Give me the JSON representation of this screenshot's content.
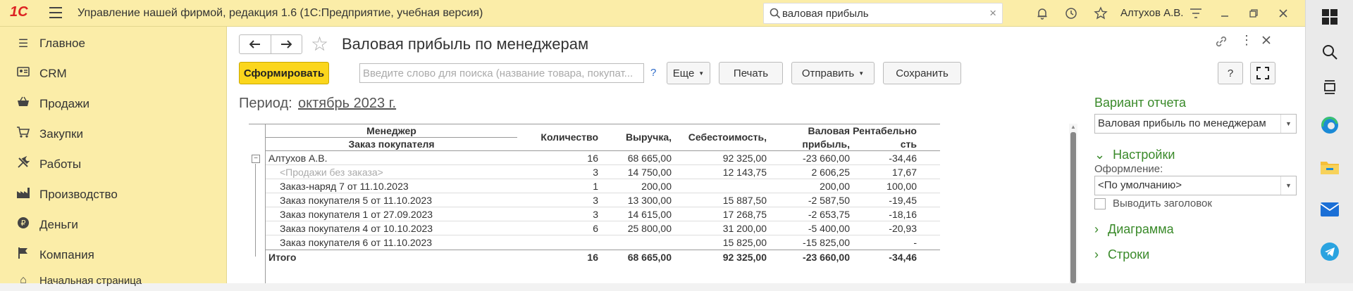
{
  "app": {
    "logo_text": "1С",
    "title": "Управление нашей фирмой, редакция 1.6  (1С:Предприятие, учебная версия)",
    "search_value": "валовая прибыль",
    "user": "Алтухов А.В."
  },
  "sidebar": {
    "items": [
      {
        "label": "Главное",
        "icon": "list-icon"
      },
      {
        "label": "CRM",
        "icon": "crm-icon"
      },
      {
        "label": "Продажи",
        "icon": "basket-icon"
      },
      {
        "label": "Закупки",
        "icon": "cart-icon"
      },
      {
        "label": "Работы",
        "icon": "tools-icon"
      },
      {
        "label": "Производство",
        "icon": "factory-icon"
      },
      {
        "label": "Деньги",
        "icon": "money-icon"
      },
      {
        "label": "Компания",
        "icon": "flag-icon"
      }
    ],
    "bottom_item": "Начальная страница"
  },
  "form": {
    "title": "Валовая прибыль по менеджерам",
    "buttons": {
      "generate": "Сформировать",
      "more": "Еще",
      "print": "Печать",
      "send": "Отправить",
      "save": "Сохранить",
      "help": "?"
    },
    "search_placeholder": "Введите слово для поиска (название товара, покупат...",
    "search_help": "?",
    "period_label": "Период:",
    "period_value": "октябрь 2023 г."
  },
  "report": {
    "headers": {
      "manager": "Менеджер",
      "order": "Заказ покупателя",
      "qty": "Количество",
      "revenue": "Выручка,",
      "cost": "Себестоимость,",
      "gross_1": "Валовая",
      "gross_2": "прибыль,",
      "rent_1": "Рентабельно",
      "rent_2": "сть"
    },
    "rows": [
      {
        "name": "Алтухов А.В.",
        "qty": "16",
        "revenue": "68 665,00",
        "cost": "92 325,00",
        "gross": "-23 660,00",
        "rent": "-34,46"
      },
      {
        "name": "<Продажи без заказа>",
        "qty": "3",
        "revenue": "14 750,00",
        "cost": "12 143,75",
        "gross": "2 606,25",
        "rent": "17,67"
      },
      {
        "name": "Заказ-наряд 7 от 11.10.2023",
        "qty": "1",
        "revenue": "200,00",
        "cost": "",
        "gross": "200,00",
        "rent": "100,00"
      },
      {
        "name": "Заказ покупателя 5 от 11.10.2023",
        "qty": "3",
        "revenue": "13 300,00",
        "cost": "15 887,50",
        "gross": "-2 587,50",
        "rent": "-19,45"
      },
      {
        "name": "Заказ покупателя 1 от 27.09.2023",
        "qty": "3",
        "revenue": "14 615,00",
        "cost": "17 268,75",
        "gross": "-2 653,75",
        "rent": "-18,16"
      },
      {
        "name": "Заказ покупателя 4 от 10.10.2023",
        "qty": "6",
        "revenue": "25 800,00",
        "cost": "31 200,00",
        "gross": "-5 400,00",
        "rent": "-20,93"
      },
      {
        "name": "Заказ покупателя 6 от 11.10.2023",
        "qty": "",
        "revenue": "",
        "cost": "15 825,00",
        "gross": "-15 825,00",
        "rent": "-"
      }
    ],
    "total": {
      "name": "Итого",
      "qty": "16",
      "revenue": "68 665,00",
      "cost": "92 325,00",
      "gross": "-23 660,00",
      "rent": "-34,46"
    }
  },
  "panel": {
    "variant_title": "Вариант отчета",
    "variant_value": "Валовая прибыль по менеджерам",
    "settings_title": "Настройки",
    "design_label": "Оформление:",
    "design_value": "<По умолчанию>",
    "show_header_label": "Выводить заголовок",
    "diagram_title": "Диаграмма",
    "rows_title": "Строки"
  }
}
